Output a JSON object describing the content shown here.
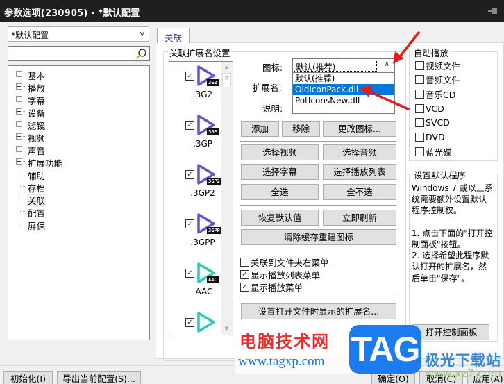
{
  "window": {
    "title": "参数选项(230905) - *默认配置",
    "pin_icon": "pin-icon"
  },
  "left": {
    "profile_select": {
      "value": "*默认配置",
      "arrow": "v"
    },
    "search": {
      "value": "",
      "placeholder": "",
      "icon": "search-icon"
    },
    "tree": [
      {
        "label": "基本",
        "expandable": true
      },
      {
        "label": "播放",
        "expandable": true
      },
      {
        "label": "字幕",
        "expandable": true
      },
      {
        "label": "设备",
        "expandable": true
      },
      {
        "label": "滤镜",
        "expandable": true
      },
      {
        "label": "视频",
        "expandable": true
      },
      {
        "label": "声音",
        "expandable": true
      },
      {
        "label": "扩展功能",
        "expandable": true
      },
      {
        "label": "辅助",
        "expandable": false
      },
      {
        "label": "存档",
        "expandable": false
      },
      {
        "label": "关联",
        "expandable": false,
        "selected": true
      },
      {
        "label": "配置",
        "expandable": false
      },
      {
        "label": "屏保",
        "expandable": false
      }
    ]
  },
  "tab": {
    "label": "关联"
  },
  "assoc": {
    "group_title": "关联扩展名设置",
    "extensions": [
      {
        "label": ".3G2",
        "badge": "3G2",
        "checked": true,
        "color": "#6a4fd8"
      },
      {
        "label": ".3GP",
        "badge": "3GP",
        "checked": true,
        "color": "#6a4fd8"
      },
      {
        "label": ".3GP2",
        "badge": "3GP2",
        "checked": true,
        "color": "#6a4fd8"
      },
      {
        "label": ".3GPP",
        "badge": "3GPP",
        "checked": true,
        "color": "#6a4fd8"
      },
      {
        "label": ".AAC",
        "badge": "AAC",
        "checked": true,
        "color": "#2ec9b0"
      },
      {
        "label": "",
        "badge": "",
        "checked": true,
        "color": "#2ec9b0"
      }
    ],
    "icon_label": "图标:",
    "icon_combo": {
      "value": "默认(推荐)",
      "arrow": "∧",
      "options": [
        "默认(推荐)",
        "OldIconPack.dll",
        "PotIconsNew.dll"
      ],
      "highlighted": "OldIconPack.dll"
    },
    "ext_label": "扩展名:",
    "ext_value": "",
    "desc_label": "说明:",
    "desc_value": "",
    "buttons": {
      "add": "添加",
      "remove": "移除",
      "change_icon": "更改图标...",
      "select_video": "选择视频",
      "select_audio": "选择音频",
      "select_subtitle": "选择字幕",
      "select_playlist": "选择播放列表",
      "select_all": "全选",
      "select_none": "全不选",
      "restore_default": "恢复默认值",
      "refresh_now": "立即刷新",
      "clear_cache": "清除缓存重建图标",
      "set_open_ext": "设置打开文件时显示的扩展名..."
    },
    "options": [
      {
        "label": "关联到文件夹右菜单",
        "checked": false
      },
      {
        "label": "显示播放列表菜单",
        "checked": true
      },
      {
        "label": "显示播放菜单",
        "checked": true
      }
    ]
  },
  "autoplay": {
    "title": "自动播放",
    "items": [
      {
        "label": "视频文件",
        "checked": false
      },
      {
        "label": "音频文件",
        "checked": false
      },
      {
        "label": "音乐CD",
        "checked": false
      },
      {
        "label": "VCD",
        "checked": false
      },
      {
        "label": "SVCD",
        "checked": false
      },
      {
        "label": "DVD",
        "checked": false
      },
      {
        "label": "蓝光碟",
        "checked": false
      }
    ]
  },
  "default_program": {
    "title": "设置默认程序",
    "text": "Windows 7 或以上系统需要额外设置默认程序控制权。\n\n1. 点击下面的\"打开控制面板\"按钮。\n2. 选择希望此程序默认打开的扩展名，然后单击\"保存\"。",
    "open_panel_button": "打开控制面板"
  },
  "footer": {
    "init": "初始化(I)",
    "export": "导出当前配置(S)...",
    "ok": "确定(O)",
    "cancel": "取消(C)",
    "apply": "应用(A)"
  },
  "watermark": {
    "site_cn": "电脑技术网",
    "site_url": "www.tagxp.com",
    "tag": "TAG",
    "brand_cn": "极光下载站",
    "brand_url": "www.xz7.com"
  },
  "annotations": {
    "arrow_color": "#e8191a"
  }
}
